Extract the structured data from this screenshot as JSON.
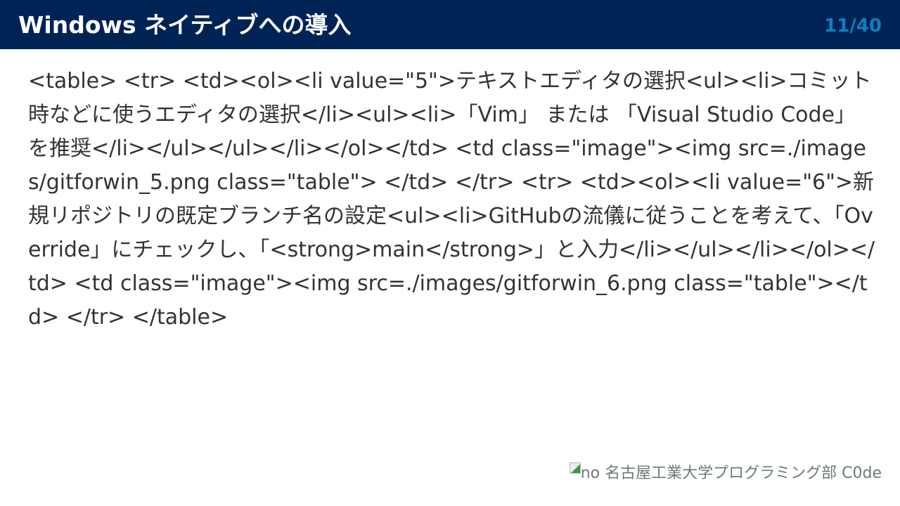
{
  "header": {
    "title": "Windows ネイティブへの導入",
    "page_number": "11/40"
  },
  "content": {
    "raw_text": "<table> <tr> <td><ol><li value=\"5\">テキストエディタの選択<ul><li>コミット時などに使うエディタの選択</li><ul><li>「Vim」 または 「Visual Studio Code」を推奨</li></ul></ul></li></ol></td> <td class=\"image\"><img src=./images/gitforwin_5.png class=\"table\"> </td> </tr> <tr> <td><ol><li value=\"6\">新規リポジトリの既定ブランチ名の設定<ul><li>GitHubの流儀に従うことを考えて、「Override」にチェックし、「<strong>main</strong>」と入力</li></ul></li></ol></td> <td class=\"image\"><img src=./images/gitforwin_6.png class=\"table\"></td> </tr> </table>"
  },
  "footer": {
    "broken_image_alt": "no",
    "text": "名古屋工業大学プログラミング部 C0de"
  },
  "colors": {
    "header_bg": "#002355",
    "page_number": "#0f7fc0",
    "body_text": "#333333",
    "footer_text": "#6c7a7c"
  }
}
